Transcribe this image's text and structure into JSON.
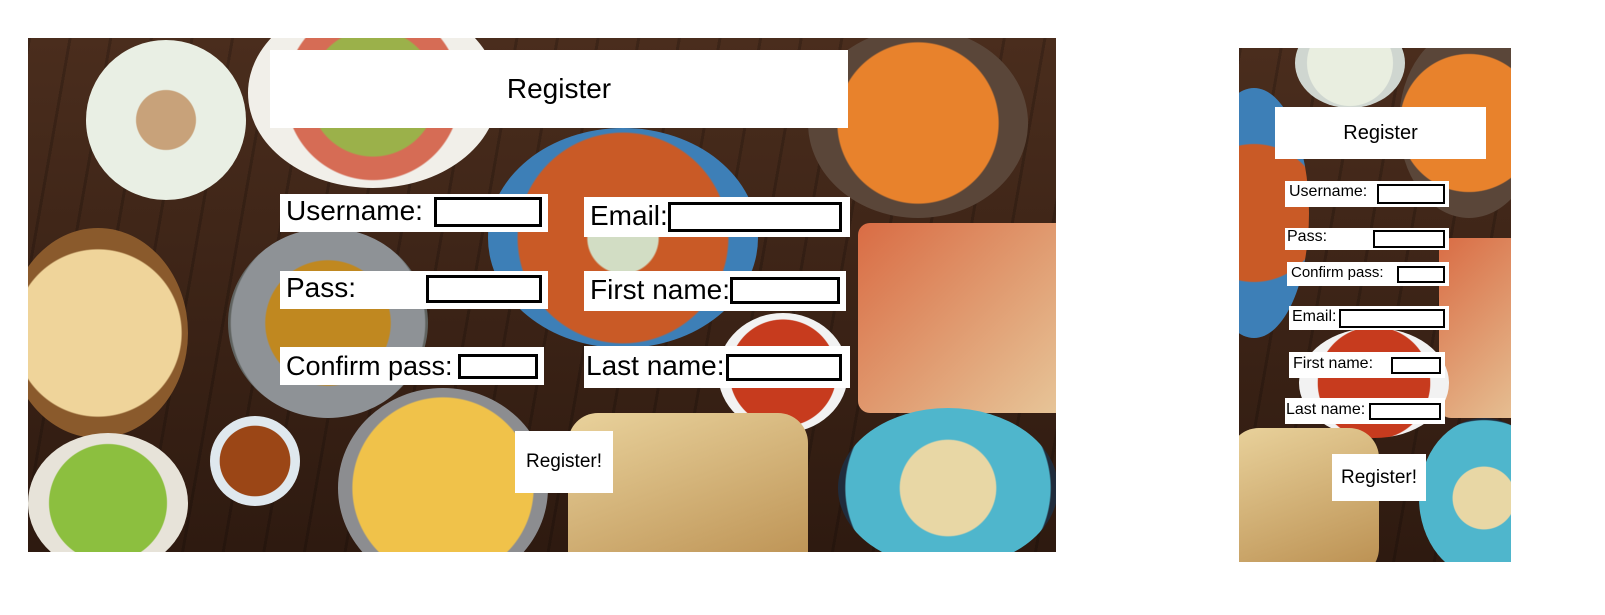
{
  "form": {
    "title": "Register",
    "submit_label": "Register!",
    "fields": {
      "username": {
        "label": "Username:",
        "value": ""
      },
      "pass": {
        "label": "Pass:",
        "value": ""
      },
      "confirm_pass": {
        "label": "Confirm pass:",
        "value": ""
      },
      "email": {
        "label": "Email:",
        "value": ""
      },
      "first_name": {
        "label": "First name:",
        "value": ""
      },
      "last_name": {
        "label": "Last name:",
        "value": ""
      }
    }
  },
  "colors": {
    "panel": "#ffffff",
    "input_border": "#000000",
    "table_wood": "#3b2418"
  }
}
